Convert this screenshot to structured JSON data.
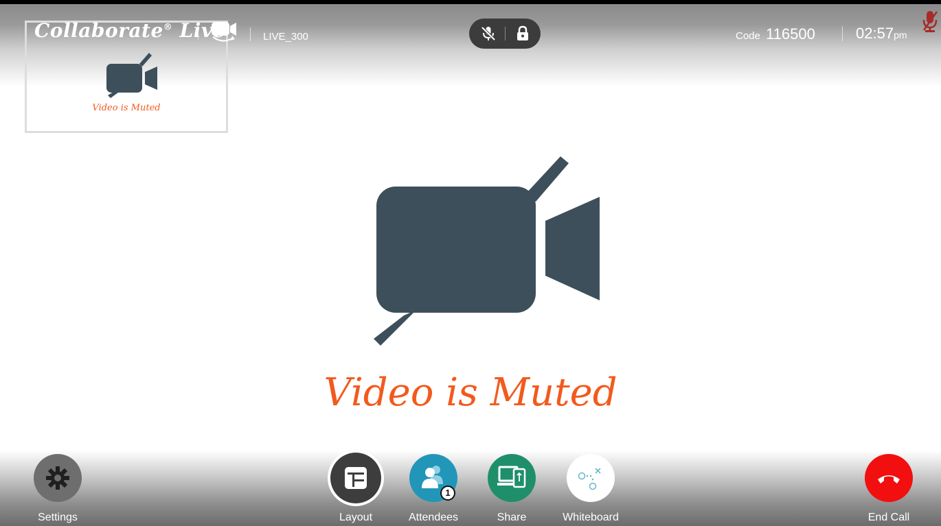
{
  "header": {
    "app_name": "Collaborate",
    "app_name_mark": "®",
    "app_name_suffix": "Live",
    "room_name": "LIVE_300",
    "code_label": "Code",
    "code_value": "116500",
    "time": "02:57",
    "time_suffix": "pm",
    "icons": {
      "camera_switch": "camera-switch-icon",
      "mic_muted": "mic-muted-icon",
      "lock": "lock-icon",
      "local_mic_muted": "mic-muted-indicator-icon"
    }
  },
  "self_view": {
    "label": "Video is Muted",
    "icon": "video-muted-icon"
  },
  "main_view": {
    "label": "Video is Muted",
    "icon": "video-muted-icon"
  },
  "controls": {
    "settings": {
      "label": "Settings",
      "icon": "gear-icon",
      "color": "#6e6e6e"
    },
    "layout": {
      "label": "Layout",
      "icon": "layout-icon",
      "color": "#3d3d3d"
    },
    "attendees": {
      "label": "Attendees",
      "icon": "people-icon",
      "color": "#2196b8",
      "badge": "1"
    },
    "share": {
      "label": "Share",
      "icon": "share-screen-icon",
      "color": "#1f8f6b"
    },
    "whiteboard": {
      "label": "Whiteboard",
      "icon": "whiteboard-icon",
      "color": "#ffffff"
    },
    "end_call": {
      "label": "End Call",
      "icon": "hang-up-icon",
      "color": "#f20f0f"
    }
  },
  "colors": {
    "muted_text": "#f25a1d",
    "camera_icon": "#3d4f5a"
  }
}
